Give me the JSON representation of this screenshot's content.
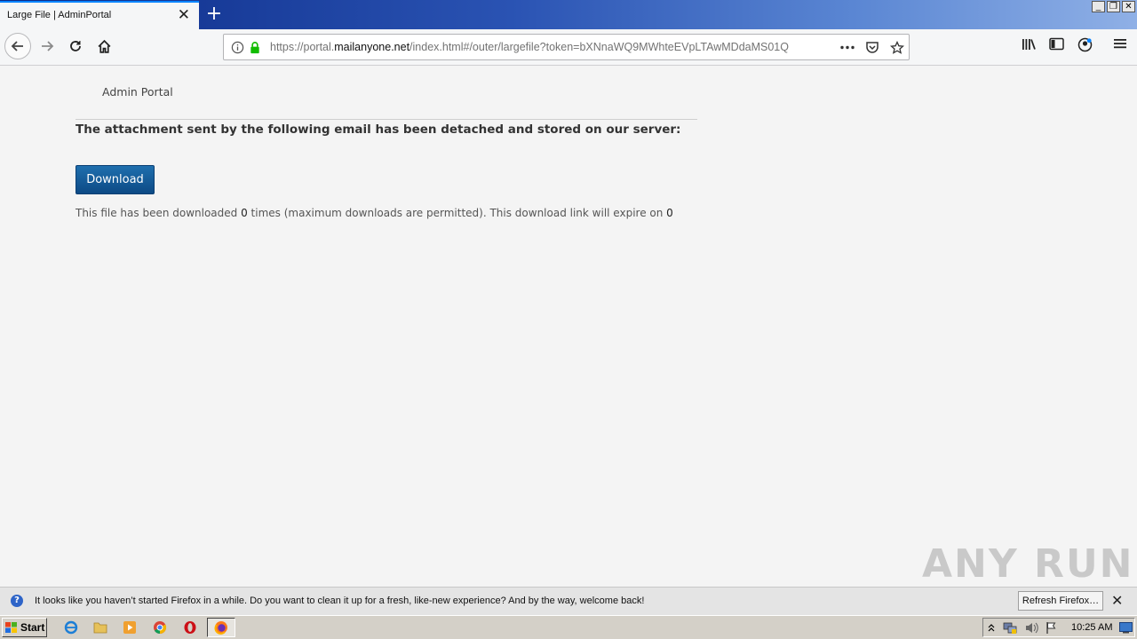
{
  "browser": {
    "tab_title": "Large File | AdminPortal",
    "tab_close": "✕",
    "new_tab": "+",
    "url_prefix": "https://portal.",
    "url_host": "mailanyone.net",
    "url_path": "/index.html#/outer/largefile?token=bXNnaWQ9MWhteEVpLTAwMDdaMS01Q",
    "window_buttons": [
      "_",
      "❐",
      "✕"
    ],
    "accent": "#0a84ff"
  },
  "page": {
    "brand": "Admin Portal",
    "heading": "The attachment sent by the following email has been detached and stored on our server:",
    "download_label": "Download",
    "info_prefix": "This file has been downloaded ",
    "download_count": "0",
    "info_middle": " times (maximum downloads are permitted). This download link will expire on ",
    "expire_value": "0",
    "button_color": "#125a98"
  },
  "watermark": "ANY RUN",
  "notification": {
    "text": "It looks like you haven’t started Firefox in a while. Do you want to clean it up for a fresh, like-new experience? And by the way, welcome back!",
    "button": "Refresh Firefox…",
    "close": "✕"
  },
  "taskbar": {
    "start_label": "Start",
    "clock": "10:25 AM"
  }
}
